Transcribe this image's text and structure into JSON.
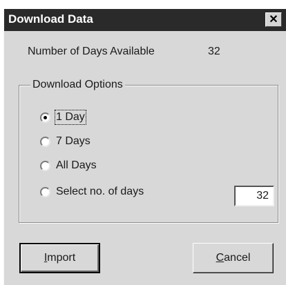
{
  "window": {
    "title": "Download Data",
    "close_label": "✕"
  },
  "info": {
    "days_available_label": "Number of Days Available",
    "days_available_value": "32"
  },
  "download_options": {
    "legend": "Download Options",
    "options": [
      {
        "label": "1 Day",
        "checked": true
      },
      {
        "label": "7 Days",
        "checked": false
      },
      {
        "label": "All Days",
        "checked": false
      },
      {
        "label": "Select no. of days",
        "checked": false
      }
    ],
    "days_input_value": "32"
  },
  "buttons": {
    "import_mnemonic": "I",
    "import_rest": "mport",
    "cancel_mnemonic": "C",
    "cancel_rest": "ancel"
  }
}
